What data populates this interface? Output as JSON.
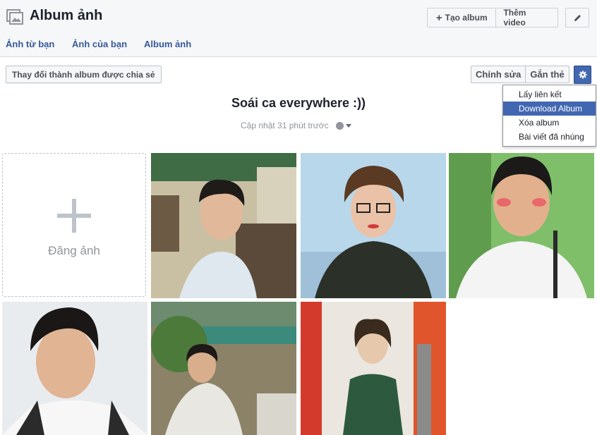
{
  "header": {
    "title": "Album ảnh",
    "create_album_label": "Tạo album",
    "add_video_label": "Thêm video"
  },
  "subnav": [
    {
      "label": "Ảnh từ bạn"
    },
    {
      "label": "Ảnh của bạn"
    },
    {
      "label": "Album ảnh"
    }
  ],
  "toolbar": {
    "share_label": "Thay đổi thành album được chia sẻ",
    "edit_label": "Chỉnh sửa",
    "tag_label": "Gắn thẻ"
  },
  "dropdown": {
    "items": [
      {
        "label": "Lấy liên kết"
      },
      {
        "label": "Download Album",
        "highlighted": true
      },
      {
        "label": "Xóa album"
      },
      {
        "label": "Bài viết đã nhúng"
      }
    ]
  },
  "album": {
    "title": "Soái ca everywhere :))",
    "updated": "Cập nhật 31 phút trước",
    "privacy_icon": "globe-icon",
    "add_photo_label": "Đăng ảnh"
  },
  "colors": {
    "accent": "#4267b2",
    "link": "#365899",
    "header_bg": "#f6f7f9"
  }
}
